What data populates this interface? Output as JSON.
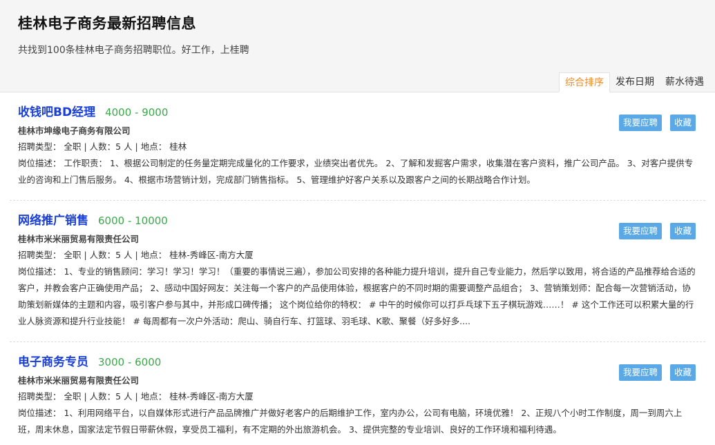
{
  "header": {
    "title": "桂林电子商务最新招聘信息",
    "subtitle": "共找到100条桂林电子商务招聘职位。好工作，上桂聘",
    "sort_tabs": [
      "综合排序",
      "发布日期",
      "薪水待遇"
    ]
  },
  "labels": {
    "apply": "我要应聘",
    "favorite": "收藏"
  },
  "jobs": [
    {
      "title": "收钱吧BD经理",
      "salary": "4000 - 9000",
      "company": "桂林市坤缘电子商务有限公司",
      "meta": "招聘类型： 全职 | 人数：5 人 | 地点： 桂林",
      "desc": "岗位描述： 工作职责： 1、根据公司制定的任务量定期完成量化的工作要求，业绩突出者优先。 2、了解和发掘客户需求，收集潜在客户资料，推广公司产品。 3、对客户提供专业的咨询和上门售后服务。 4、根据市场营销计划，完成部门销售指标。 5、管理维护好客户关系以及跟客户之间的长期战略合作计划。"
    },
    {
      "title": "网络推广销售",
      "salary": "6000 - 10000",
      "company": "桂林市米米丽贸易有限责任公司",
      "meta": "招聘类型： 全职 | 人数：5 人 | 地点： 桂林-秀峰区-南方大厦",
      "desc": "岗位描述： 1、专业的销售顾问：学习！学习！学习！（重要的事情说三遍），参加公司安排的各种能力提升培训，提升自己专业能力，然后学以致用，将合适的产品推荐给合适的客户，并教会客户正确使用产品； 2、感动中国好网友：关注每一个客户的产品使用体验，根据客户的不同时期的需要调整产品组合； 3、营销策划师：配合每一次营销活动，协助策划新媒体的主题和内容，吸引客户参与其中，并形成口碑传播； 这个岗位给你的特权： # 中午的时候你可以打乒乓球下五子棋玩游戏……！ # 这个工作还可以积累大量的行业人脉资源和提升行业技能！ # 每周都有一次户外活动：爬山、骑自行车、打篮球、羽毛球、K歌、聚餐（好多好多...."
    },
    {
      "title": "电子商务专员",
      "salary": "3000 - 6000",
      "company": "桂林市米米丽贸易有限责任公司",
      "meta": "招聘类型： 全职 | 人数：5 人 | 地点： 桂林-秀峰区-南方大厦",
      "desc": "岗位描述： 1、利用网络平台，以自媒体形式进行产品品牌推广并做好老客户的后期维护工作，室内办公，公司有电脑，环境优雅！ 2、正规八个小时工作制度，周一到周六上班，周末休息，国家法定节假日带薪休假，享受员工福利，有不定期的外出旅游机会。 3、提供完整的专业培训、良好的工作环境和福利待遇。"
    }
  ]
}
